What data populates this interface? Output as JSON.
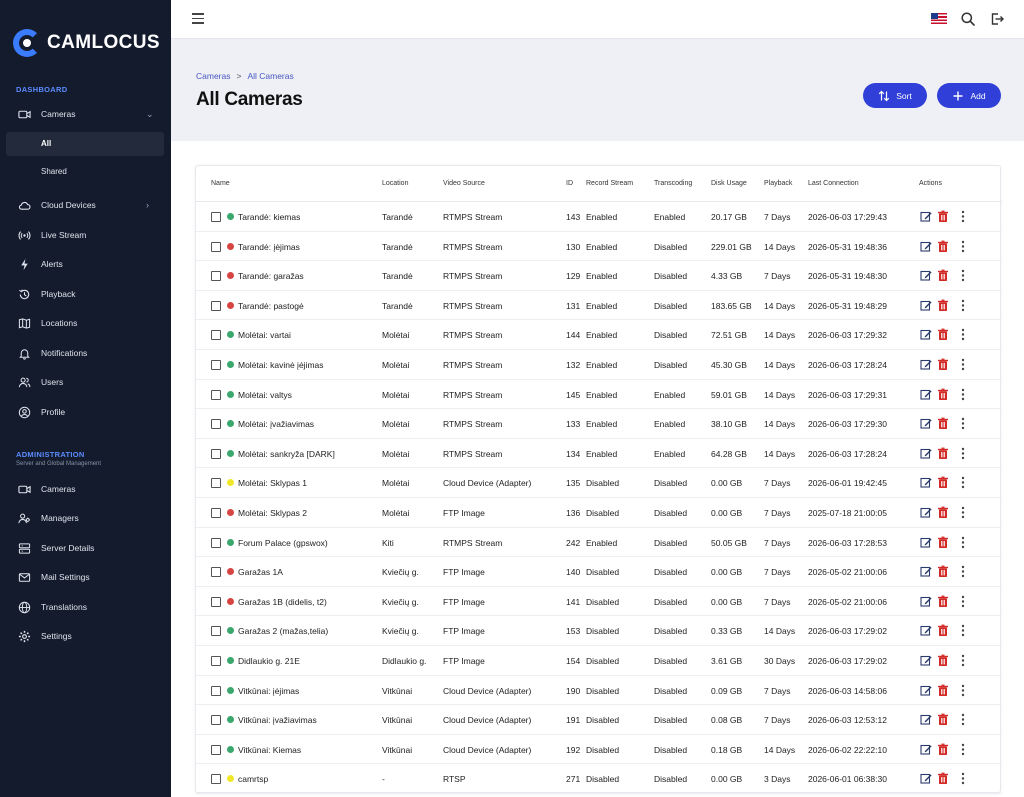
{
  "brand": {
    "name": "CAMLOCUS",
    "accent": "#3b7cff"
  },
  "sidebar": {
    "dashboard_label": "DASHBOARD",
    "dashboard_items": [
      {
        "label": "Cameras",
        "icon": "video-icon"
      },
      {
        "label": "Cloud Devices",
        "icon": "cloud-icon"
      },
      {
        "label": "Live Stream",
        "icon": "broadcast-icon"
      },
      {
        "label": "Alerts",
        "icon": "bolt-icon"
      },
      {
        "label": "Playback",
        "icon": "history-icon"
      },
      {
        "label": "Locations",
        "icon": "map-icon"
      },
      {
        "label": "Notifications",
        "icon": "bell-icon"
      },
      {
        "label": "Users",
        "icon": "users-icon"
      },
      {
        "label": "Profile",
        "icon": "profile-icon"
      }
    ],
    "cameras_subitems": [
      {
        "label": "All"
      },
      {
        "label": "Shared"
      }
    ],
    "admin_label": "ADMINISTRATION",
    "admin_sub": "Server and Global Management",
    "admin_items": [
      {
        "label": "Cameras",
        "icon": "video-icon"
      },
      {
        "label": "Managers",
        "icon": "managers-icon"
      },
      {
        "label": "Server Details",
        "icon": "server-icon"
      },
      {
        "label": "Mail Settings",
        "icon": "mail-icon"
      },
      {
        "label": "Translations",
        "icon": "globe-icon"
      },
      {
        "label": "Settings",
        "icon": "gear-icon"
      }
    ]
  },
  "header": {
    "breadcrumb": [
      "Cameras",
      "All Cameras"
    ],
    "title": "All Cameras",
    "sort_label": "Sort",
    "add_label": "Add"
  },
  "status_colors": {
    "green": "#3aa76d",
    "red": "#d64541",
    "yellow": "#f1e72a"
  },
  "table": {
    "columns": [
      "Name",
      "Location",
      "Video Source",
      "ID",
      "Record Stream",
      "Transcoding",
      "Disk Usage",
      "Playback",
      "Last Connection",
      "Actions"
    ],
    "rows": [
      {
        "status": "green",
        "name": "Tarandė: kiemas",
        "location": "Tarandė",
        "source": "RTMPS Stream",
        "id": "143",
        "record": "Enabled",
        "transcoding": "Enabled",
        "disk": "20.17 GB",
        "playback": "7 Days",
        "last": "2026-06-03 17:29:43"
      },
      {
        "status": "red",
        "name": "Tarandė: įėjimas",
        "location": "Tarandė",
        "source": "RTMPS Stream",
        "id": "130",
        "record": "Enabled",
        "transcoding": "Disabled",
        "disk": "229.01 GB",
        "playback": "14 Days",
        "last": "2026-05-31 19:48:36"
      },
      {
        "status": "red",
        "name": "Tarandė: garažas",
        "location": "Tarandė",
        "source": "RTMPS Stream",
        "id": "129",
        "record": "Enabled",
        "transcoding": "Disabled",
        "disk": "4.33 GB",
        "playback": "7 Days",
        "last": "2026-05-31 19:48:30"
      },
      {
        "status": "red",
        "name": "Tarandė: pastogė",
        "location": "Tarandė",
        "source": "RTMPS Stream",
        "id": "131",
        "record": "Enabled",
        "transcoding": "Disabled",
        "disk": "183.65 GB",
        "playback": "14 Days",
        "last": "2026-05-31 19:48:29"
      },
      {
        "status": "green",
        "name": "Molėtai: vartai",
        "location": "Molėtai",
        "source": "RTMPS Stream",
        "id": "144",
        "record": "Enabled",
        "transcoding": "Disabled",
        "disk": "72.51 GB",
        "playback": "14 Days",
        "last": "2026-06-03 17:29:32"
      },
      {
        "status": "green",
        "name": "Molėtai: kavinė įėjimas",
        "location": "Molėtai",
        "source": "RTMPS Stream",
        "id": "132",
        "record": "Enabled",
        "transcoding": "Disabled",
        "disk": "45.30 GB",
        "playback": "14 Days",
        "last": "2026-06-03 17:28:24"
      },
      {
        "status": "green",
        "name": "Molėtai: valtys",
        "location": "Molėtai",
        "source": "RTMPS Stream",
        "id": "145",
        "record": "Enabled",
        "transcoding": "Enabled",
        "disk": "59.01 GB",
        "playback": "14 Days",
        "last": "2026-06-03 17:29:31"
      },
      {
        "status": "green",
        "name": "Molėtai: įvažiavimas",
        "location": "Molėtai",
        "source": "RTMPS Stream",
        "id": "133",
        "record": "Enabled",
        "transcoding": "Enabled",
        "disk": "38.10 GB",
        "playback": "14 Days",
        "last": "2026-06-03 17:29:30"
      },
      {
        "status": "green",
        "name": "Molėtai: sankryža [DARK]",
        "location": "Molėtai",
        "source": "RTMPS Stream",
        "id": "134",
        "record": "Enabled",
        "transcoding": "Enabled",
        "disk": "64.28 GB",
        "playback": "14 Days",
        "last": "2026-06-03 17:28:24"
      },
      {
        "status": "yellow",
        "name": "Molėtai: Sklypas 1",
        "location": "Molėtai",
        "source": "Cloud Device (Adapter)",
        "id": "135",
        "record": "Disabled",
        "transcoding": "Disabled",
        "disk": "0.00 GB",
        "playback": "7 Days",
        "last": "2026-06-01 19:42:45"
      },
      {
        "status": "red",
        "name": "Molėtai: Sklypas 2",
        "location": "Molėtai",
        "source": "FTP Image",
        "id": "136",
        "record": "Disabled",
        "transcoding": "Disabled",
        "disk": "0.00 GB",
        "playback": "7 Days",
        "last": "2025-07-18 21:00:05"
      },
      {
        "status": "green",
        "name": "Forum Palace (gpswox)",
        "location": "Kiti",
        "source": "RTMPS Stream",
        "id": "242",
        "record": "Enabled",
        "transcoding": "Disabled",
        "disk": "50.05 GB",
        "playback": "7 Days",
        "last": "2026-06-03 17:28:53"
      },
      {
        "status": "red",
        "name": "Garažas 1A",
        "location": "Kviečių g.",
        "source": "FTP Image",
        "id": "140",
        "record": "Disabled",
        "transcoding": "Disabled",
        "disk": "0.00 GB",
        "playback": "7 Days",
        "last": "2026-05-02 21:00:06"
      },
      {
        "status": "red",
        "name": "Garažas 1B (didelis, t2)",
        "location": "Kviečių g.",
        "source": "FTP Image",
        "id": "141",
        "record": "Disabled",
        "transcoding": "Disabled",
        "disk": "0.00 GB",
        "playback": "7 Days",
        "last": "2026-05-02 21:00:06"
      },
      {
        "status": "green",
        "name": "Garažas 2 (mažas,telia)",
        "location": "Kviečių g.",
        "source": "FTP Image",
        "id": "153",
        "record": "Disabled",
        "transcoding": "Disabled",
        "disk": "0.33 GB",
        "playback": "14 Days",
        "last": "2026-06-03 17:29:02"
      },
      {
        "status": "green",
        "name": "Didlaukio g. 21E",
        "location": "Didlaukio g.",
        "source": "FTP Image",
        "id": "154",
        "record": "Disabled",
        "transcoding": "Disabled",
        "disk": "3.61 GB",
        "playback": "30 Days",
        "last": "2026-06-03 17:29:02"
      },
      {
        "status": "green",
        "name": "Vitkūnai: įėjimas",
        "location": "Vitkūnai",
        "source": "Cloud Device (Adapter)",
        "id": "190",
        "record": "Disabled",
        "transcoding": "Disabled",
        "disk": "0.09 GB",
        "playback": "7 Days",
        "last": "2026-06-03 14:58:06"
      },
      {
        "status": "green",
        "name": "Vitkūnai: įvažiavimas",
        "location": "Vitkūnai",
        "source": "Cloud Device (Adapter)",
        "id": "191",
        "record": "Disabled",
        "transcoding": "Disabled",
        "disk": "0.08 GB",
        "playback": "7 Days",
        "last": "2026-06-03 12:53:12"
      },
      {
        "status": "green",
        "name": "Vitkūnai: Kiemas",
        "location": "Vitkūnai",
        "source": "Cloud Device (Adapter)",
        "id": "192",
        "record": "Disabled",
        "transcoding": "Disabled",
        "disk": "0.18 GB",
        "playback": "14 Days",
        "last": "2026-06-02 22:22:10"
      },
      {
        "status": "yellow",
        "name": "camrtsp",
        "location": "-",
        "source": "RTSP",
        "id": "271",
        "record": "Disabled",
        "transcoding": "Disabled",
        "disk": "0.00 GB",
        "playback": "3 Days",
        "last": "2026-06-01 06:38:30"
      }
    ]
  }
}
